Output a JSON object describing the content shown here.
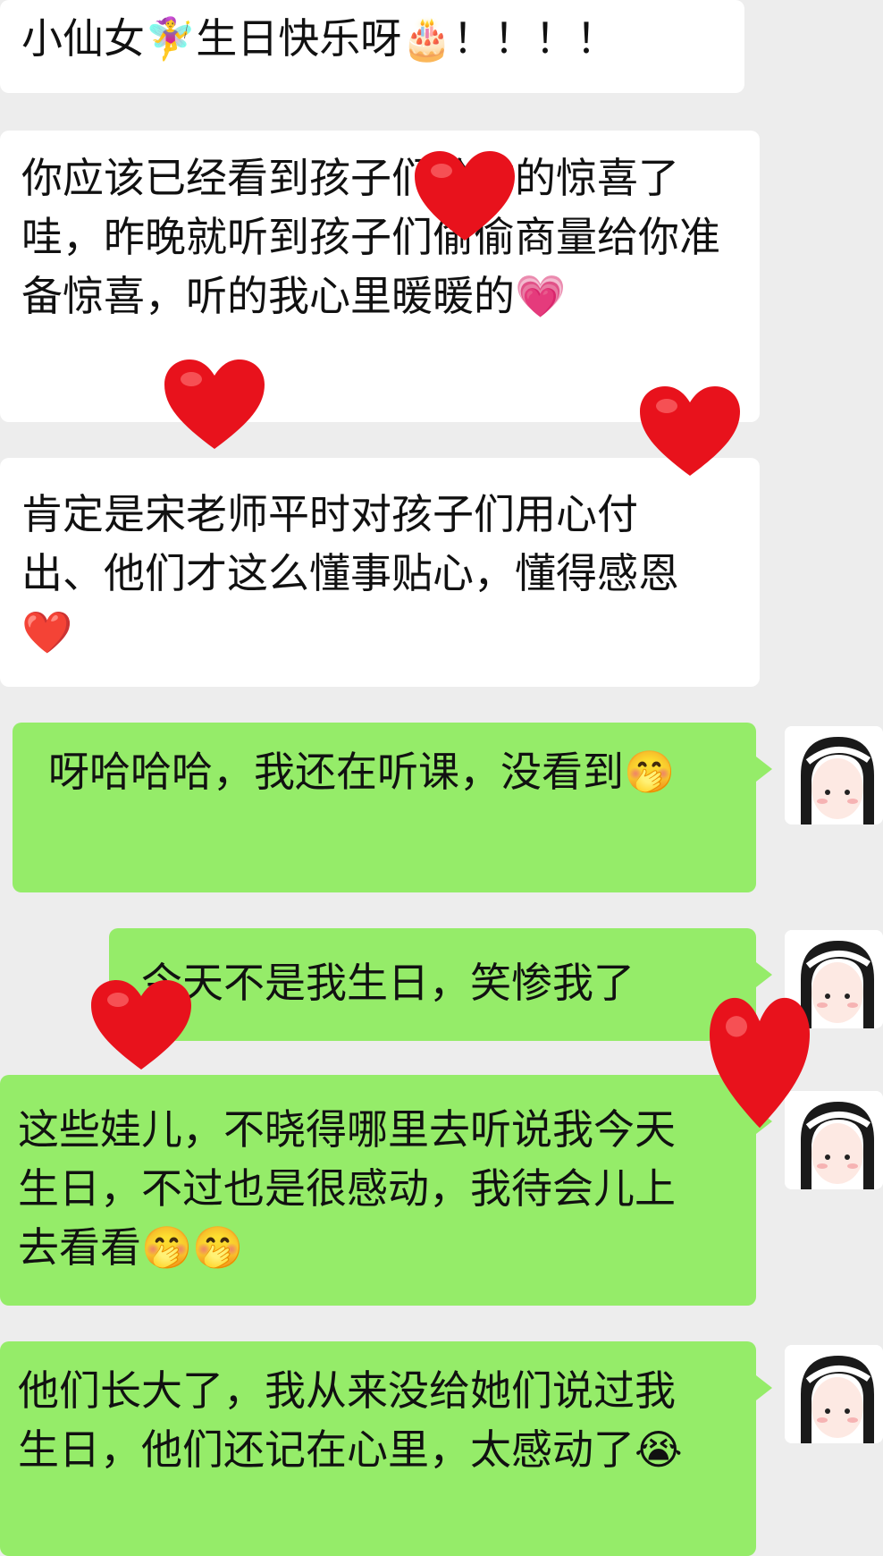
{
  "messages": [
    {
      "side": "left",
      "text": "小仙女🧚‍♀️生日快乐呀🎂！！！！"
    },
    {
      "side": "left",
      "text": "你应该已经看到孩子们给你的惊喜了哇，昨晚就听到孩子们偷偷商量给你准备惊喜，听的我心里暖暖的💗"
    },
    {
      "side": "left",
      "text": "肯定是宋老师平时对孩子们用心付出、他们才这么懂事贴心，懂得感恩❤️"
    },
    {
      "side": "right",
      "text": "呀哈哈哈，我还在听课，没看到🤭"
    },
    {
      "side": "right",
      "text": "今天不是我生日，笑惨我了"
    },
    {
      "side": "right",
      "text": "这些娃儿，不晓得哪里去听说我今天生日，不过也是很感动，我待会儿上去看看🤭🤭"
    },
    {
      "side": "right",
      "text": "他们长大了，我从来没给她们说过我生日，他们还记在心里，太感动了😭"
    }
  ],
  "colors": {
    "background": "#ededed",
    "incoming_bubble": "#ffffff",
    "outgoing_bubble": "#95ec69",
    "heart_sticker": "#e8121c"
  },
  "icons": {
    "avatar": "cartoon-girl-avatar",
    "sticker": "red-heart-sticker"
  }
}
